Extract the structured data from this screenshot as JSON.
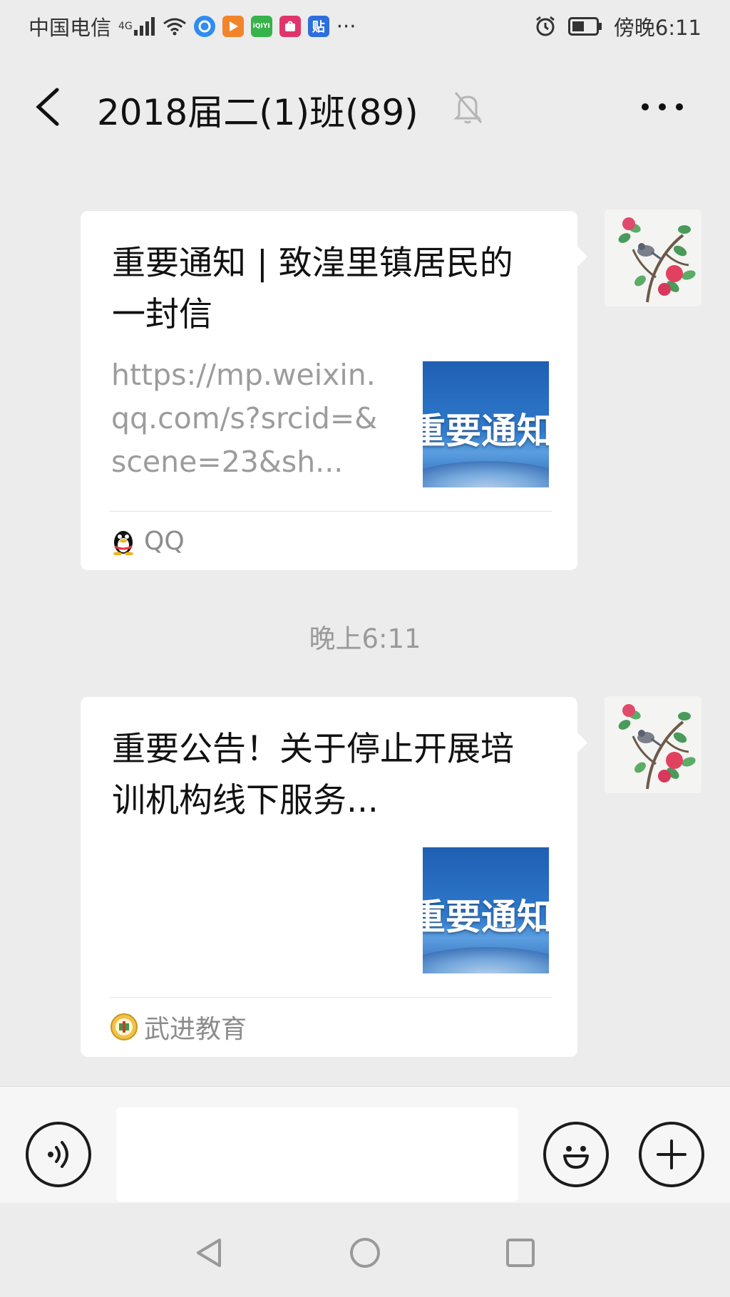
{
  "status_bar": {
    "carrier": "中国电信",
    "signal_badge": "4G",
    "app_icons": [
      "qq-browser-icon",
      "video-app-icon",
      "iqiyi-icon",
      "vipshop-icon",
      "tieba-icon"
    ],
    "tieba_glyph": "贴",
    "iqiyi_glyph": "iQIYI",
    "overflow": "···",
    "time": "傍晚6:11"
  },
  "header": {
    "title": "2018届二(1)班(89)"
  },
  "messages": [
    {
      "title": "重要通知 | 致湟里镇居民的一封信",
      "description": "https://mp.weixin.qq.com/s?srcid=&scene=23&sh...",
      "thumb_text": "重要通知",
      "source": "QQ"
    },
    {
      "title": "重要公告！关于停止开展培训机构线下服务...",
      "description": "",
      "thumb_text": "重要通知",
      "source": "武进教育"
    }
  ],
  "timestamp": "晚上6:11",
  "input": {
    "value": ""
  },
  "colors": {
    "background": "#ececec",
    "card": "#ffffff",
    "muted_text": "#9c9c9c",
    "thumb_blue": "#2f79cc"
  }
}
